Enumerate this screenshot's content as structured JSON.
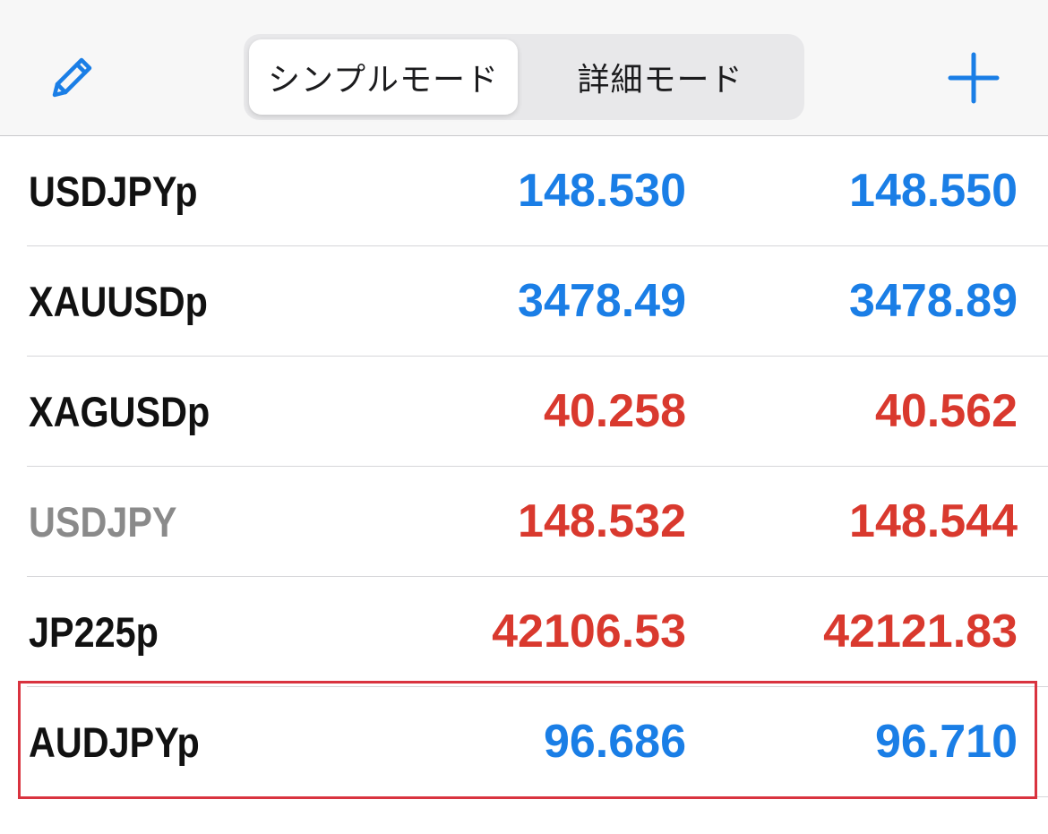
{
  "header": {
    "tabs": [
      {
        "label": "シンプルモード",
        "active": true
      },
      {
        "label": "詳細モード",
        "active": false
      }
    ],
    "left_icon": "pencil-icon",
    "right_icon": "plus-icon"
  },
  "colors": {
    "accent": "#1a7ee6",
    "up": "#1a7ee6",
    "down": "#d9392e",
    "symbol_active": "#111111",
    "symbol_inactive": "#8a8a8a",
    "highlight": "#d9333f"
  },
  "quotes": [
    {
      "symbol": "USDJPYp",
      "bid": "148.530",
      "ask": "148.550",
      "direction": "up",
      "symbol_state": "active"
    },
    {
      "symbol": "XAUUSDp",
      "bid": "3478.49",
      "ask": "3478.89",
      "direction": "up",
      "symbol_state": "active"
    },
    {
      "symbol": "XAGUSDp",
      "bid": "40.258",
      "ask": "40.562",
      "direction": "down",
      "symbol_state": "active"
    },
    {
      "symbol": "USDJPY",
      "bid": "148.532",
      "ask": "148.544",
      "direction": "down",
      "symbol_state": "inactive"
    },
    {
      "symbol": "JP225p",
      "bid": "42106.53",
      "ask": "42121.83",
      "direction": "down",
      "symbol_state": "active"
    },
    {
      "symbol": "AUDJPYp",
      "bid": "96.686",
      "ask": "96.710",
      "direction": "up",
      "symbol_state": "active",
      "highlighted": true
    }
  ]
}
